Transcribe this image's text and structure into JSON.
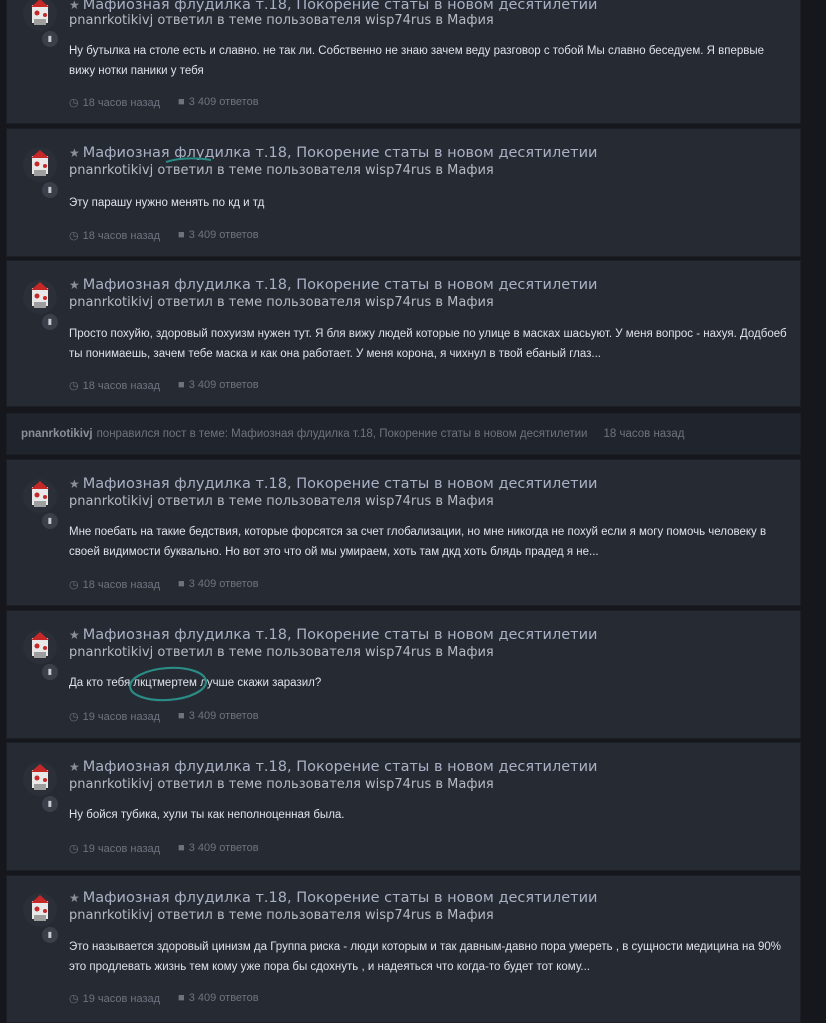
{
  "topic_title": "Мафиозная флудилка т.18, Покорение статы в новом десятилетии",
  "posts": [
    {
      "author_line": "pnanrkotikivj ответил в теме пользователя wisp74rus в Мафия",
      "body": "Ну бутылка на столе есть и славно. не так ли. Собственно не знаю зачем веду разговор с тобой Мы славно беседуем. Я впервые вижу нотки паники у тебя",
      "time": "18 часов назад",
      "replies": "3 409 ответов"
    },
    {
      "author_line": "pnanrkotikivj ответил в теме пользователя wisp74rus в Мафия",
      "body": "Эту парашу нужно менять по кд и тд",
      "time": "18 часов назад",
      "replies": "3 409 ответов"
    },
    {
      "author_line": "pnanrkotikivj ответил в теме пользователя wisp74rus в Мафия",
      "body": "Просто похуйю, здоровый похуизм нужен тут. Я бля вижу людей которые по улице в масках шасьуют. У меня вопрос - нахуя. Додбоеб ты понимаешь, зачем тебе маска и как она работает. У меня корона, я чихнул в твой ебаный глаз...",
      "time": "18 часов назад",
      "replies": "3 409 ответов"
    },
    {
      "author_line": "pnanrkotikivj ответил в теме пользователя wisp74rus в Мафия",
      "body": "Мне поебать на такие бедствия, которые форсятся за счет глобализации, но мне никогда не похуй если я могу помочь человеку в своей видимости буквально. Но вот это что ой мы умираем, хоть там дкд хоть блядь прадед я не...",
      "time": "18 часов назад",
      "replies": "3 409 ответов"
    },
    {
      "author_line": "pnanrkotikivj ответил в теме пользователя wisp74rus в Мафия",
      "body": "Да кто тебя лкцтмертем лучше скажи заразил?",
      "time": "19 часов назад",
      "replies": "3 409 ответов"
    },
    {
      "author_line": "pnanrkotikivj ответил в теме пользователя wisp74rus в Мафия",
      "body": "Ну бойся тубика, хули ты как неполноценная была.",
      "time": "19 часов назад",
      "replies": "3 409 ответов"
    },
    {
      "author_line": "pnanrkotikivj ответил в теме пользователя wisp74rus в Мафия",
      "body": "Это называется здоровый цинизм да Группа риска - люди которым и так давным-давно пора умереть , в сущности медицина на 90% это продлевать жизнь тем кому уже пора бы сдохнуть , и надеяться что когда-то будет тот кому...",
      "time": "19 часов назад",
      "replies": "3 409 ответов"
    }
  ],
  "like_activity": {
    "user": "pnanrkotikivj",
    "text": "понравился пост в теме: Мафиозная флудилка т.18, Покорение статы в новом десятилетии",
    "time": "18 часов назад"
  },
  "icons": {
    "star": "star-icon",
    "clock": "clock-icon",
    "comment": "comment-icon",
    "avatar_badge": "speech-bubble-icon"
  },
  "colors": {
    "background": "#15171d",
    "card": "#262a33",
    "title": "#aab1c5",
    "annotation": "#2a8c86"
  }
}
